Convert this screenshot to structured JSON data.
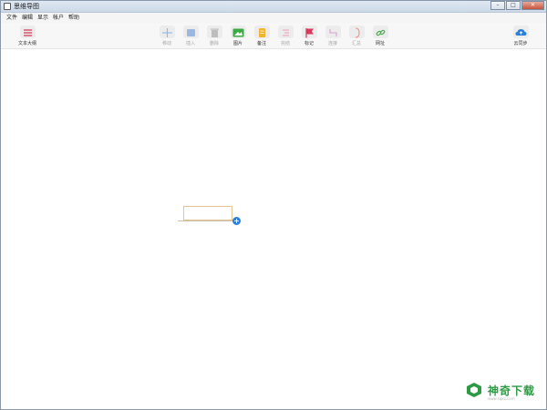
{
  "window": {
    "title": "思维导图"
  },
  "menu": [
    "文件",
    "编辑",
    "显示",
    "帐户",
    "帮助"
  ],
  "toolbar": {
    "outline": {
      "label": "文本大纲",
      "icon": "list-icon"
    },
    "tools": [
      {
        "label": "移动",
        "icon": "move-icon",
        "enabled": false
      },
      {
        "label": "插入",
        "icon": "insert-icon",
        "enabled": false
      },
      {
        "label": "删除",
        "icon": "trash-icon",
        "enabled": false
      },
      {
        "label": "图片",
        "icon": "image-icon",
        "enabled": true
      },
      {
        "label": "备注",
        "icon": "note-icon",
        "enabled": true
      },
      {
        "label": "完结",
        "icon": "finish-icon",
        "enabled": false
      },
      {
        "label": "标记",
        "icon": "flag-icon",
        "enabled": true
      },
      {
        "label": "连接",
        "icon": "connect-icon",
        "enabled": false
      },
      {
        "label": "汇总",
        "icon": "summary-icon",
        "enabled": false
      },
      {
        "label": "网址",
        "icon": "link-icon",
        "enabled": true
      }
    ],
    "cloud_sync": {
      "label": "云同步",
      "icon": "cloud-icon"
    }
  },
  "canvas": {
    "add_button": "+"
  },
  "watermark": {
    "text": "神奇下载",
    "sub": "www.sqxz.com"
  },
  "colors": {
    "accent": "#2f7fd6",
    "flag": "#d63a5c",
    "image_green": "#3aaa45",
    "note_yellow": "#f0b52a",
    "link_green": "#4caf50"
  }
}
